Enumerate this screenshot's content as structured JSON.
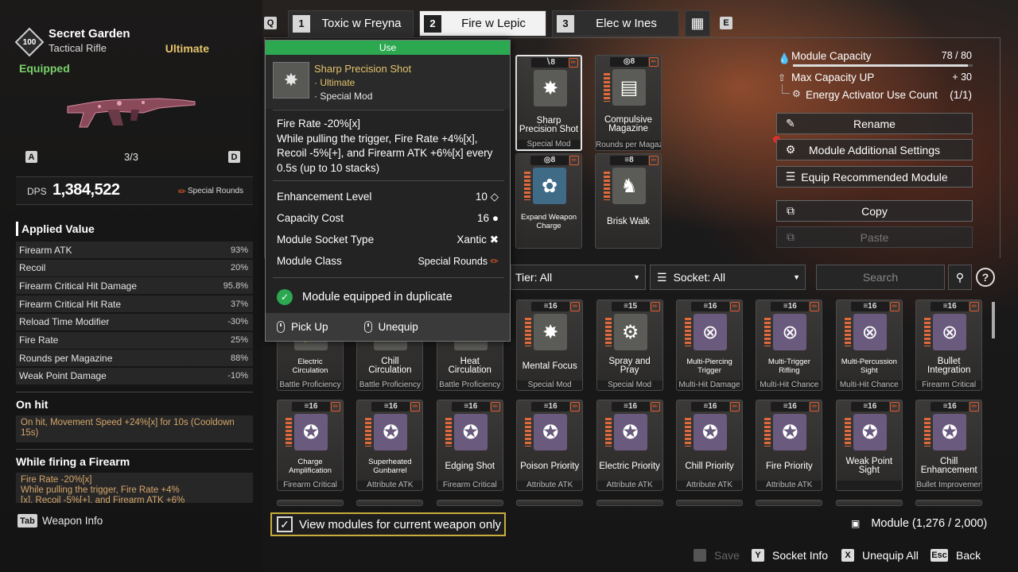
{
  "weapon": {
    "level": "100",
    "name": "Secret Garden",
    "type": "Tactical Rifle",
    "tier": "Ultimate",
    "status": "Equipped",
    "slot": "3/3",
    "prev_key": "A",
    "next_key": "D"
  },
  "dps": {
    "label": "DPS",
    "value": "1,384,522",
    "ammo": "Special Rounds"
  },
  "applied": {
    "title": "Applied Value",
    "stats": [
      {
        "name": "Firearm ATK",
        "value": "93%"
      },
      {
        "name": "Recoil",
        "value": "20%"
      },
      {
        "name": "Firearm Critical Hit Damage",
        "value": "95.8%"
      },
      {
        "name": "Firearm Critical Hit Rate",
        "value": "37%"
      },
      {
        "name": "Reload Time Modifier",
        "value": "-30%"
      },
      {
        "name": "Fire Rate",
        "value": "25%"
      },
      {
        "name": "Rounds per Magazine",
        "value": "88%"
      },
      {
        "name": "Weak Point Damage",
        "value": "-10%"
      }
    ]
  },
  "onhit": {
    "title": "On hit",
    "text": "On hit, Movement Speed +24%[x] for 10s (Cooldown 15s)"
  },
  "firing": {
    "title": "While firing a Firearm",
    "text": "Fire Rate -20%[x]\nWhile pulling the trigger, Fire Rate +4%\n[x], Recoil -5%[+], and Firearm ATK +6%"
  },
  "weapon_info": {
    "key": "Tab",
    "label": "Weapon Info"
  },
  "tabs": [
    {
      "key": "Q"
    },
    {
      "num": "1",
      "label": "Toxic w Freyna"
    },
    {
      "num": "2",
      "label": "Fire w Lepic"
    },
    {
      "num": "3",
      "label": "Elec w Ines"
    },
    {
      "key": "E"
    }
  ],
  "equipped_modules": [
    {
      "cap": "8",
      "name": "Sharp Precision Shot",
      "class": "Special Mod"
    },
    {
      "cap": "8",
      "name": "Compulsive Magazine",
      "class": "Rounds per Magazine"
    },
    {
      "cap": "8",
      "name": "Expand Weapon Charge",
      "class": ""
    },
    {
      "cap": "8",
      "name": "Brisk Walk",
      "class": ""
    }
  ],
  "capacity": {
    "label": "Module Capacity",
    "value": "78 / 80",
    "fill": 0.975,
    "max_label": "Max Capacity UP",
    "max_value": "+ 30",
    "energy_label": "Energy Activator Use Count",
    "energy_value": "(1/1)"
  },
  "actions": {
    "rename": "Rename",
    "additional": "Module Additional Settings",
    "recommended": "Equip Recommended Module",
    "copy": "Copy",
    "paste": "Paste"
  },
  "filters": {
    "tier": "Tier: All",
    "socket": "Socket: All",
    "search_placeholder": "Search"
  },
  "popup": {
    "use": "Use",
    "name": "Sharp Precision Shot",
    "tier": "· Ultimate",
    "type": "· Special Mod",
    "desc": "Fire Rate -20%[x]\nWhile pulling the trigger, Fire Rate +4%[x], Recoil -5%[+], and Firearm ATK +6%[x] every 0.5s (up to 10 stacks)",
    "rows": [
      {
        "label": "Enhancement Level",
        "value": "10"
      },
      {
        "label": "Capacity Cost",
        "value": "16"
      },
      {
        "label": "Module Socket Type",
        "value": "Xantic"
      },
      {
        "label": "Module Class",
        "value": "Special Rounds"
      }
    ],
    "duplicate": "Module equipped in duplicate",
    "pickup": "Pick Up",
    "unequip": "Unequip"
  },
  "inventory_row1": [
    {
      "cap": "",
      "name": "Electric Circulation",
      "class": "Battle Proficiency"
    },
    {
      "cap": "",
      "name": "Chill Circulation",
      "class": "Battle Proficiency"
    },
    {
      "cap": "",
      "name": "Heat Circulation",
      "class": "Battle Proficiency"
    },
    {
      "cap": "16",
      "name": "Mental Focus",
      "class": "Special Mod"
    },
    {
      "cap": "15",
      "name": "Spray and Pray",
      "class": "Special Mod"
    },
    {
      "cap": "16",
      "name": "Multi-Piercing Trigger",
      "class": "Multi-Hit Damage"
    },
    {
      "cap": "16",
      "name": "Multi-Trigger Rifling",
      "class": "Multi-Hit Chance"
    },
    {
      "cap": "16",
      "name": "Multi-Percussion Sight",
      "class": "Multi-Hit Chance"
    },
    {
      "cap": "16",
      "name": "Bullet Integration",
      "class": "Firearm Critical"
    }
  ],
  "inventory_row2": [
    {
      "cap": "16",
      "name": "Charge Amplification",
      "class": "Firearm Critical"
    },
    {
      "cap": "16",
      "name": "Superheated Gunbarrel",
      "class": "Attribute ATK"
    },
    {
      "cap": "16",
      "name": "Edging Shot",
      "class": "Firearm Critical"
    },
    {
      "cap": "16",
      "name": "Poison Priority",
      "class": "Attribute ATK"
    },
    {
      "cap": "16",
      "name": "Electric Priority",
      "class": "Attribute ATK"
    },
    {
      "cap": "16",
      "name": "Chill Priority",
      "class": "Attribute ATK"
    },
    {
      "cap": "16",
      "name": "Fire Priority",
      "class": "Attribute ATK"
    },
    {
      "cap": "16",
      "name": "Weak Point Sight",
      "class": ""
    },
    {
      "cap": "16",
      "name": "Chill Enhancement",
      "class": "Bullet Improvement"
    }
  ],
  "view_current": "View modules for current weapon only",
  "module_count": "Module (1,276 / 2,000)",
  "bottom_actions": [
    {
      "key": "",
      "label": "Save"
    },
    {
      "key": "Y",
      "label": "Socket Info"
    },
    {
      "key": "X",
      "label": "Unequip All"
    },
    {
      "key": "Esc",
      "label": "Back"
    }
  ],
  "colors": {
    "accent_gold": "#e3c36b",
    "equipped_green": "#7ad16b",
    "use_green": "#2ca850",
    "note_orange": "#d6a76a",
    "warn_red": "#e45b2b"
  }
}
